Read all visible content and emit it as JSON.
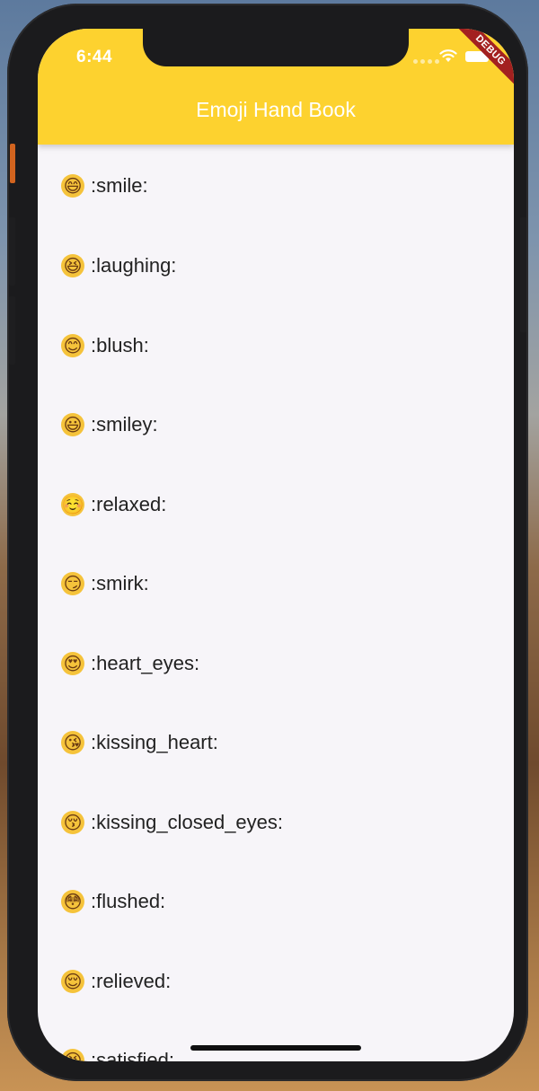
{
  "status_bar": {
    "time": "6:44"
  },
  "debug_banner": "DEBUG",
  "app_bar": {
    "title": "Emoji Hand Book",
    "color": "#fdd22f"
  },
  "emoji_list": [
    {
      "emoji": "😄",
      "name": ":smile:"
    },
    {
      "emoji": "😆",
      "name": ":laughing:"
    },
    {
      "emoji": "😊",
      "name": ":blush:"
    },
    {
      "emoji": "😃",
      "name": ":smiley:"
    },
    {
      "emoji": "☺️",
      "name": ":relaxed:"
    },
    {
      "emoji": "😏",
      "name": ":smirk:"
    },
    {
      "emoji": "😍",
      "name": ":heart_eyes:"
    },
    {
      "emoji": "😘",
      "name": ":kissing_heart:"
    },
    {
      "emoji": "😚",
      "name": ":kissing_closed_eyes:"
    },
    {
      "emoji": "😳",
      "name": ":flushed:"
    },
    {
      "emoji": "😌",
      "name": ":relieved:"
    },
    {
      "emoji": "😆",
      "name": ":satisfied:"
    }
  ]
}
